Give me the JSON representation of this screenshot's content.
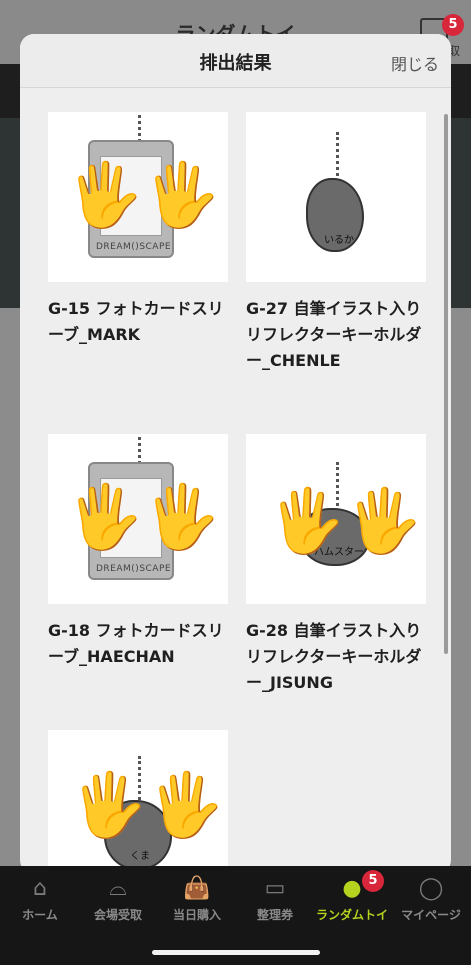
{
  "background": {
    "title": "ランダムトイ",
    "box_badge": "5",
    "box_label": "取"
  },
  "modal": {
    "title": "排出結果",
    "close_label": "閉じる"
  },
  "items": [
    {
      "label": "G-15 フォトカードスリーブ_MARK",
      "kind": "sleeve",
      "sleeve_text": "DREAM()SCAPE"
    },
    {
      "label": "G-27 自筆イラスト入りリフレクターキーホルダー_CHENLE",
      "kind": "charm",
      "charm_text": "いるか"
    },
    {
      "label": "G-18 フォトカードスリーブ_HAECHAN",
      "kind": "sleeve",
      "sleeve_text": "DREAM()SCAPE"
    },
    {
      "label": "G-28 自筆イラスト入りリフレクターキーホルダー_JISUNG",
      "kind": "charm",
      "charm_text": "ハムスター"
    },
    {
      "label": "",
      "kind": "charm",
      "charm_text": "くま"
    }
  ],
  "tabbar": {
    "tabs": [
      {
        "label": "ホーム",
        "icon": "home-icon"
      },
      {
        "label": "会場受取",
        "icon": "venue-icon"
      },
      {
        "label": "当日購入",
        "icon": "shopping-bag-icon"
      },
      {
        "label": "整理券",
        "icon": "ticket-icon"
      },
      {
        "label": "ランダムトイ",
        "icon": "random-toy-icon",
        "badge": "5"
      },
      {
        "label": "マイページ",
        "icon": "user-icon"
      }
    ]
  },
  "colors": {
    "active_tab": "#b5d21f",
    "badge": "#d8263a"
  }
}
